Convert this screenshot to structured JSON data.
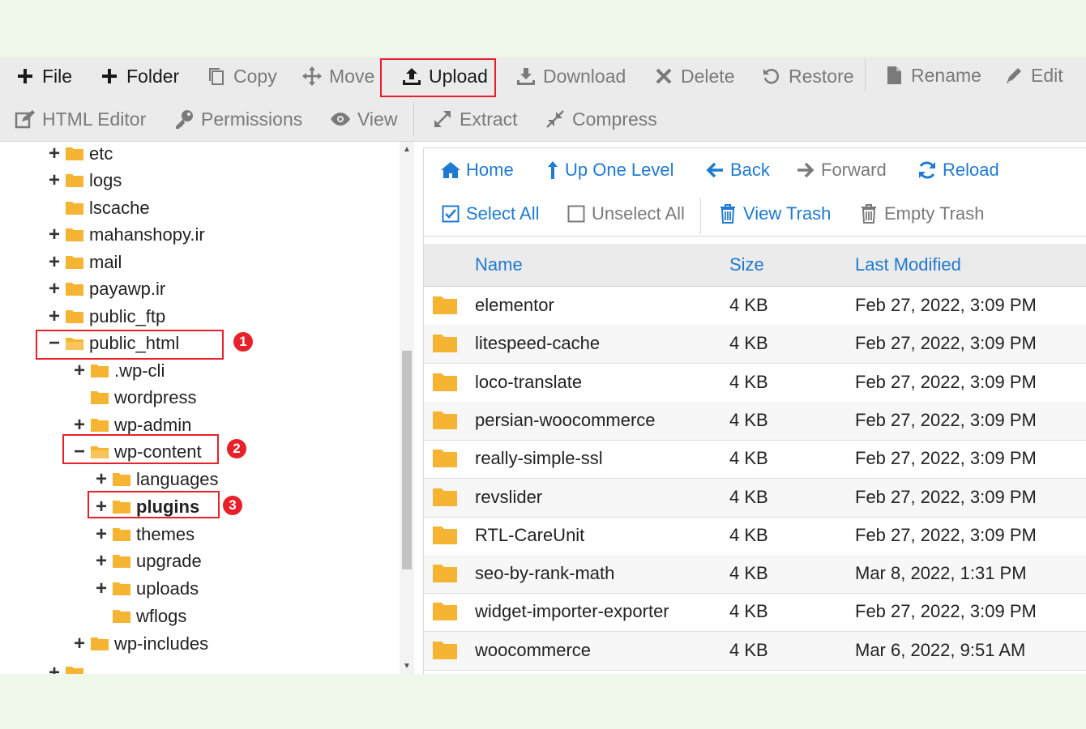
{
  "toolbar": {
    "row1": [
      {
        "label": "File",
        "icon": "plus-icon"
      },
      {
        "label": "Folder",
        "icon": "plus-icon"
      },
      {
        "label": "Copy",
        "icon": "copy-icon"
      },
      {
        "label": "Move",
        "icon": "move-icon"
      },
      {
        "label": "Upload",
        "icon": "upload-icon"
      },
      {
        "label": "Download",
        "icon": "download-icon"
      },
      {
        "label": "Delete",
        "icon": "x-icon"
      },
      {
        "label": "Restore",
        "icon": "restore-icon"
      },
      {
        "label": "Rename",
        "icon": "file-icon"
      },
      {
        "label": "Edit",
        "icon": "pencil-icon"
      }
    ],
    "row2": [
      {
        "label": "HTML Editor",
        "icon": "edit-box-icon"
      },
      {
        "label": "Permissions",
        "icon": "key-icon"
      },
      {
        "label": "View",
        "icon": "eye-icon"
      },
      {
        "label": "Extract",
        "icon": "expand-icon"
      },
      {
        "label": "Compress",
        "icon": "compress-icon"
      }
    ]
  },
  "tree": {
    "items": [
      {
        "label": "etc",
        "toggle": "+"
      },
      {
        "label": "logs",
        "toggle": "+"
      },
      {
        "label": "lscache",
        "toggle": ""
      },
      {
        "label": "mahanshopy.ir",
        "toggle": "+"
      },
      {
        "label": "mail",
        "toggle": "+"
      },
      {
        "label": "payawp.ir",
        "toggle": "+"
      },
      {
        "label": "public_ftp",
        "toggle": "+"
      },
      {
        "label": "public_html",
        "toggle": "−"
      },
      {
        "label": ".wp-cli",
        "toggle": "+"
      },
      {
        "label": "wordpress",
        "toggle": ""
      },
      {
        "label": "wp-admin",
        "toggle": "+"
      },
      {
        "label": "wp-content",
        "toggle": "−"
      },
      {
        "label": "languages",
        "toggle": "+"
      },
      {
        "label": "plugins",
        "toggle": "+"
      },
      {
        "label": "themes",
        "toggle": "+"
      },
      {
        "label": "upgrade",
        "toggle": "+"
      },
      {
        "label": "uploads",
        "toggle": "+"
      },
      {
        "label": "wflogs",
        "toggle": ""
      },
      {
        "label": "wp-includes",
        "toggle": "+"
      },
      {
        "label": "",
        "toggle": "+"
      }
    ]
  },
  "badges": [
    "1",
    "2",
    "3"
  ],
  "nav": {
    "home": "Home",
    "up": "Up One Level",
    "back": "Back",
    "forward": "Forward",
    "reload": "Reload",
    "select_all": "Select All",
    "unselect_all": "Unselect All",
    "view_trash": "View Trash",
    "empty_trash": "Empty Trash"
  },
  "table": {
    "headers": {
      "name": "Name",
      "size": "Size",
      "modified": "Last Modified"
    },
    "rows": [
      {
        "name": "elementor",
        "size": "4 KB",
        "modified": "Feb 27, 2022, 3:09 PM"
      },
      {
        "name": "litespeed-cache",
        "size": "4 KB",
        "modified": "Feb 27, 2022, 3:09 PM"
      },
      {
        "name": "loco-translate",
        "size": "4 KB",
        "modified": "Feb 27, 2022, 3:09 PM"
      },
      {
        "name": "persian-woocommerce",
        "size": "4 KB",
        "modified": "Feb 27, 2022, 3:09 PM"
      },
      {
        "name": "really-simple-ssl",
        "size": "4 KB",
        "modified": "Feb 27, 2022, 3:09 PM"
      },
      {
        "name": "revslider",
        "size": "4 KB",
        "modified": "Feb 27, 2022, 3:09 PM"
      },
      {
        "name": "RTL-CareUnit",
        "size": "4 KB",
        "modified": "Feb 27, 2022, 3:09 PM"
      },
      {
        "name": "seo-by-rank-math",
        "size": "4 KB",
        "modified": "Mar 8, 2022, 1:31 PM"
      },
      {
        "name": "widget-importer-exporter",
        "size": "4 KB",
        "modified": "Feb 27, 2022, 3:09 PM"
      },
      {
        "name": "woocommerce",
        "size": "4 KB",
        "modified": "Mar 6, 2022, 9:51 AM"
      }
    ]
  },
  "colors": {
    "accent": "#1f7ad1",
    "folder": "#f5b431",
    "highlight": "#e8202a"
  }
}
